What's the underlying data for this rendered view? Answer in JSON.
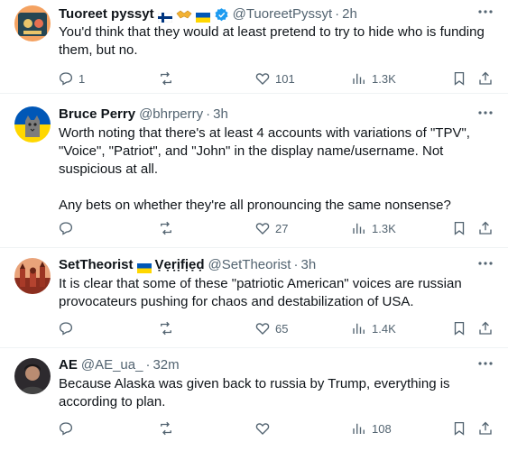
{
  "tweets": [
    {
      "author": "Tuoreet pyssyt",
      "handle": "@TuoreetPyssyt",
      "time": "2h",
      "text": "You'd think that they would at least pretend to try to hide who is funding them, but no.",
      "replies": "1",
      "likes": "101",
      "views": "1.3K",
      "badge": "verified-icon",
      "avatar_icon": "character-avatar"
    },
    {
      "author": "Bruce Perry",
      "handle": "@bhrperry",
      "time": "3h",
      "text": "Worth noting that there's at least 4 accounts with variations of \"TPV\", \"Voice\", \"Patriot\", and \"John\" in the display name/username. Not suspicious at all.\n\nAny bets on whether they're all pronouncing the same nonsense?",
      "replies": "",
      "likes": "27",
      "views": "1.3K",
      "avatar_icon": "cat-avatar"
    },
    {
      "author": "SetTheorist",
      "display_suffix": "Ṿẹṛịfịẹḍ",
      "handle": "@SetTheorist",
      "time": "3h",
      "text": "It is clear that some of these \"patriotic American\" voices are russian provocateurs pushing for chaos and destabilization of USA.",
      "replies": "",
      "likes": "65",
      "views": "1.4K",
      "avatar_icon": "cityscape-avatar"
    },
    {
      "author": "AE",
      "handle": "@AE_ua_",
      "time": "32m",
      "text": "Because Alaska was given back to russia by Trump, everything is according to plan.",
      "replies": "",
      "likes": "",
      "views": "108",
      "avatar_icon": "person-avatar"
    }
  ],
  "separator": "·",
  "colors": {
    "text": "#0f1419",
    "secondary": "#536471",
    "verified": "#1d9bf0",
    "ukraine_blue": "#0057b7",
    "ukraine_yellow": "#ffd700",
    "divider": "#eff3f4"
  }
}
